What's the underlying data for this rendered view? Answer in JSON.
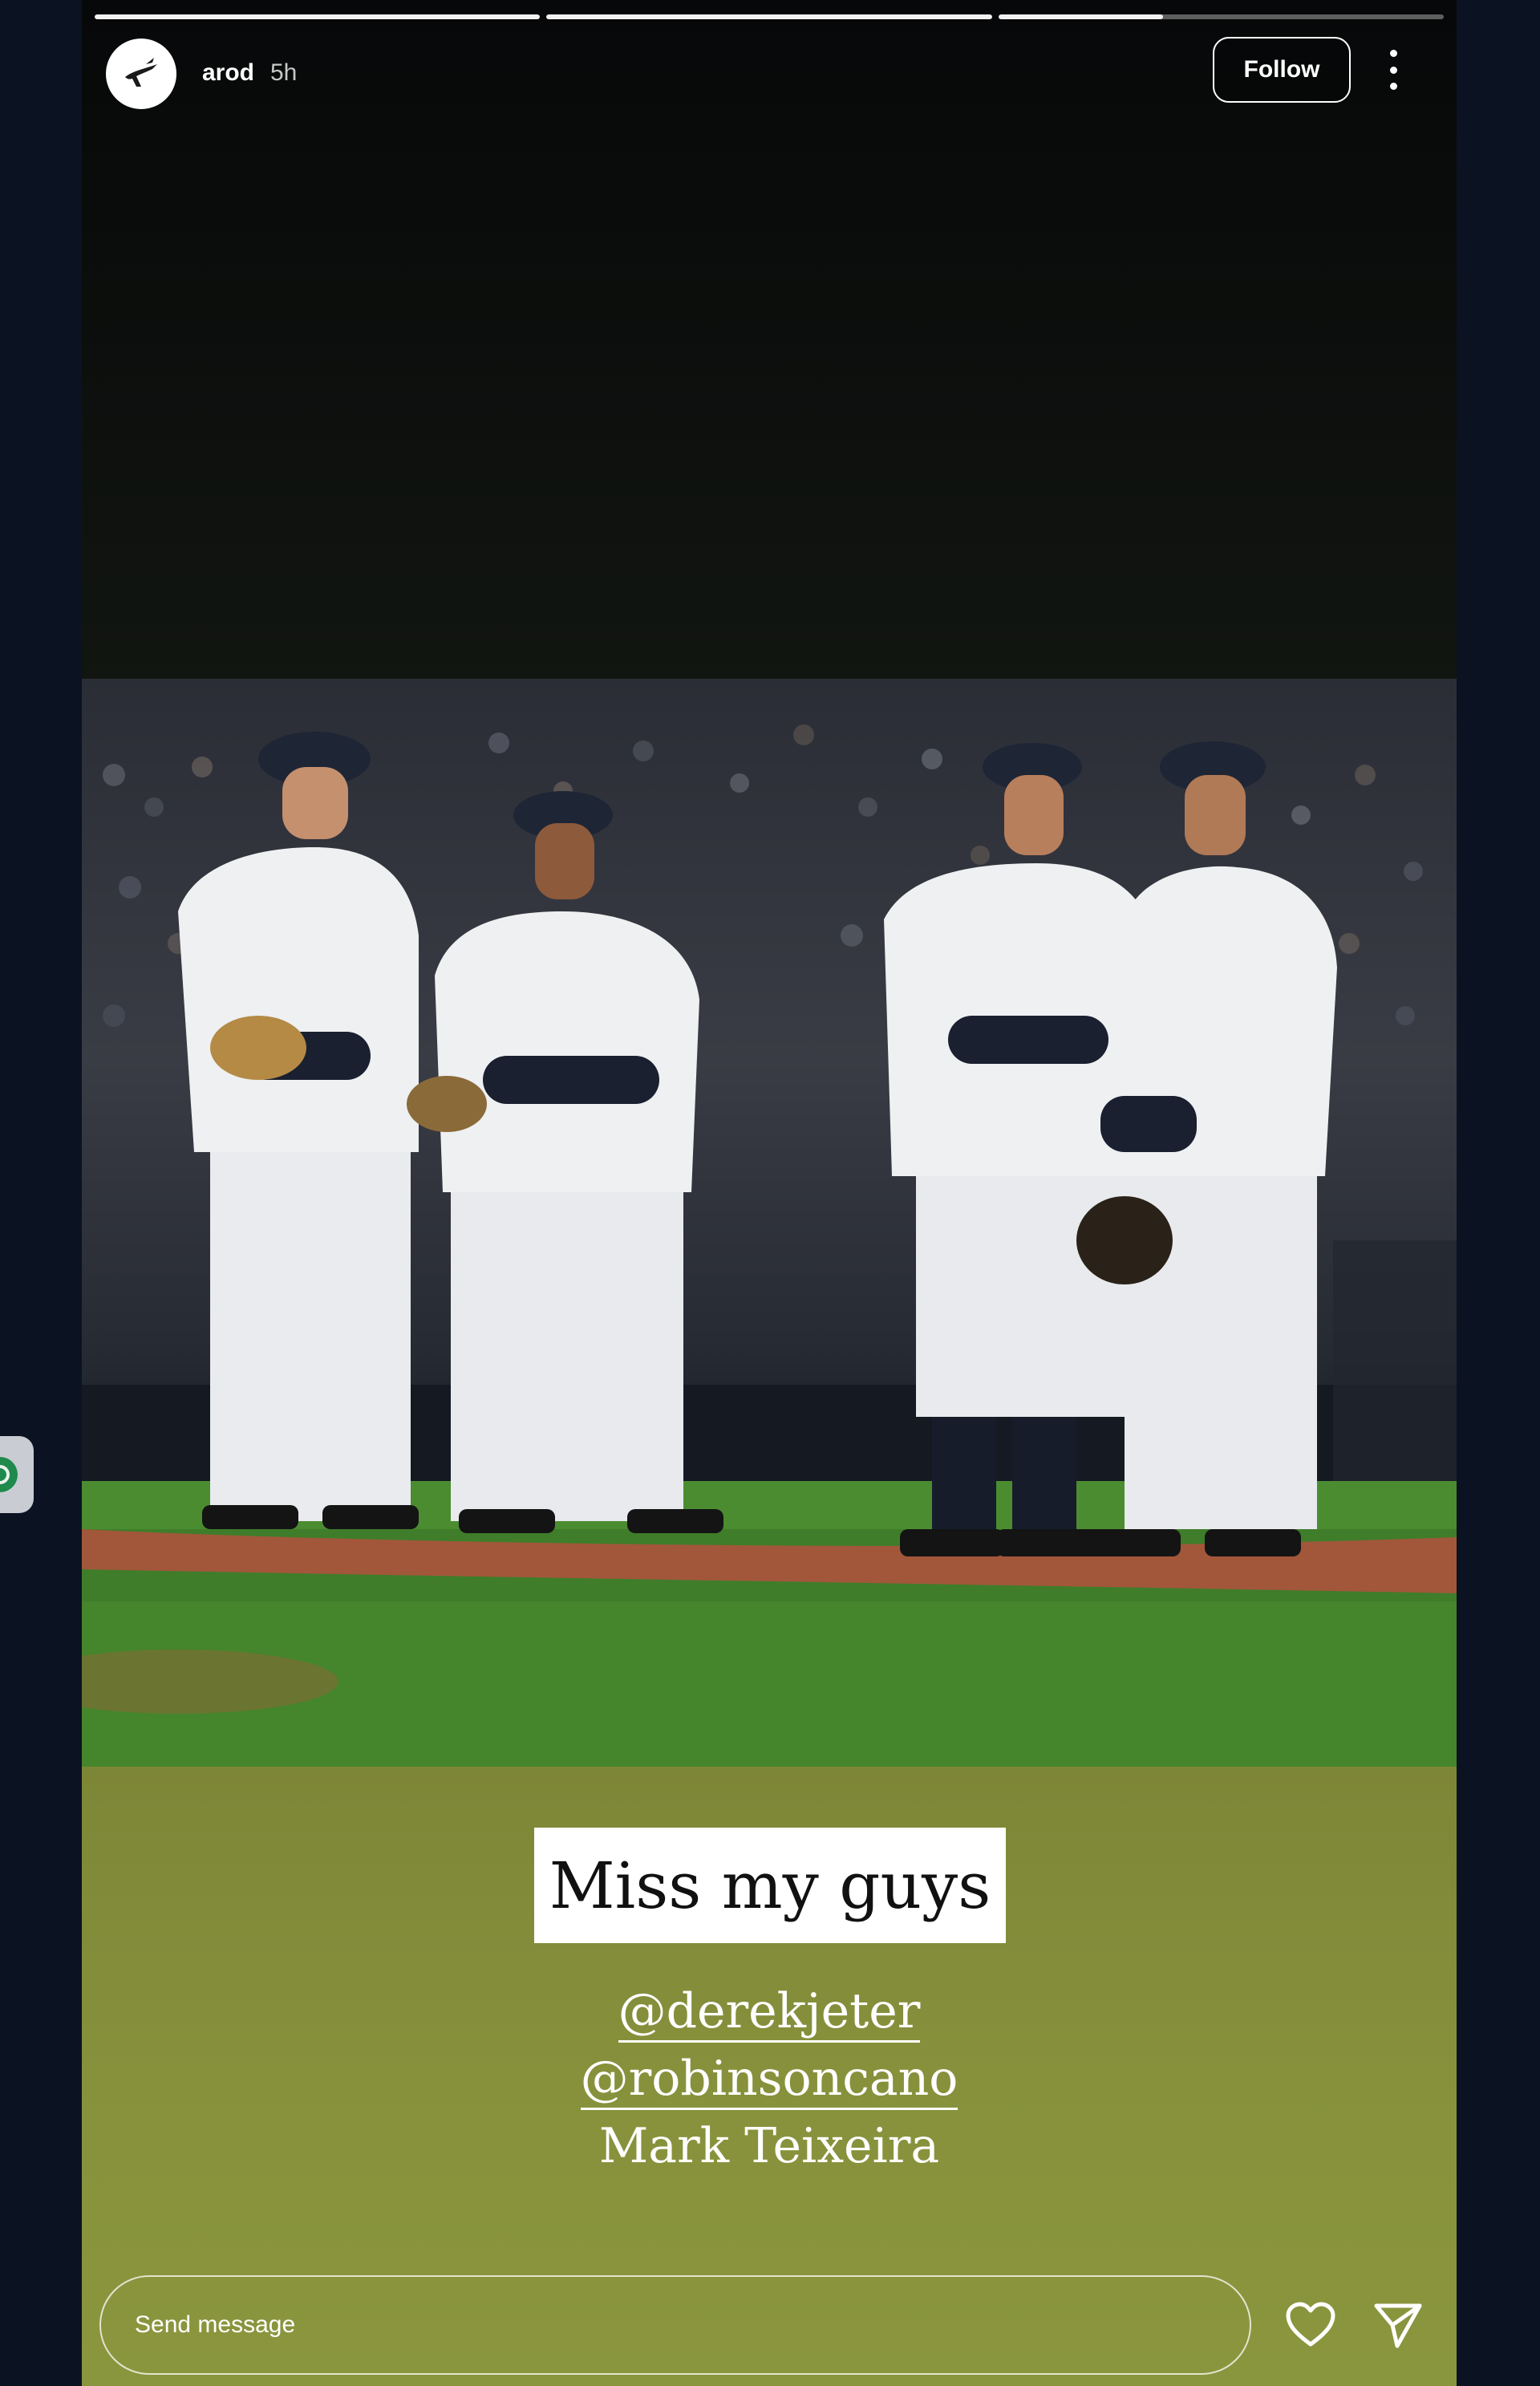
{
  "story": {
    "progress": [
      1.0,
      1.0,
      0.37
    ],
    "user": {
      "username": "arod",
      "time": "5h"
    },
    "follow_label": "Follow",
    "more_icon": "more-vertical-icon",
    "caption": "Miss my guys",
    "mentions": [
      "@derekjeter",
      "@robinsoncano"
    ],
    "tagged_text": "Mark Teixeira",
    "message_placeholder": "Send message",
    "icons": {
      "like": "heart-icon",
      "send": "send-icon",
      "side_widget": "grammarly-icon"
    }
  },
  "colors": {
    "page_background": "#0b1322",
    "caption_background": "#ffffff",
    "story_bottom": "#87913c",
    "text": "#ffffff"
  }
}
